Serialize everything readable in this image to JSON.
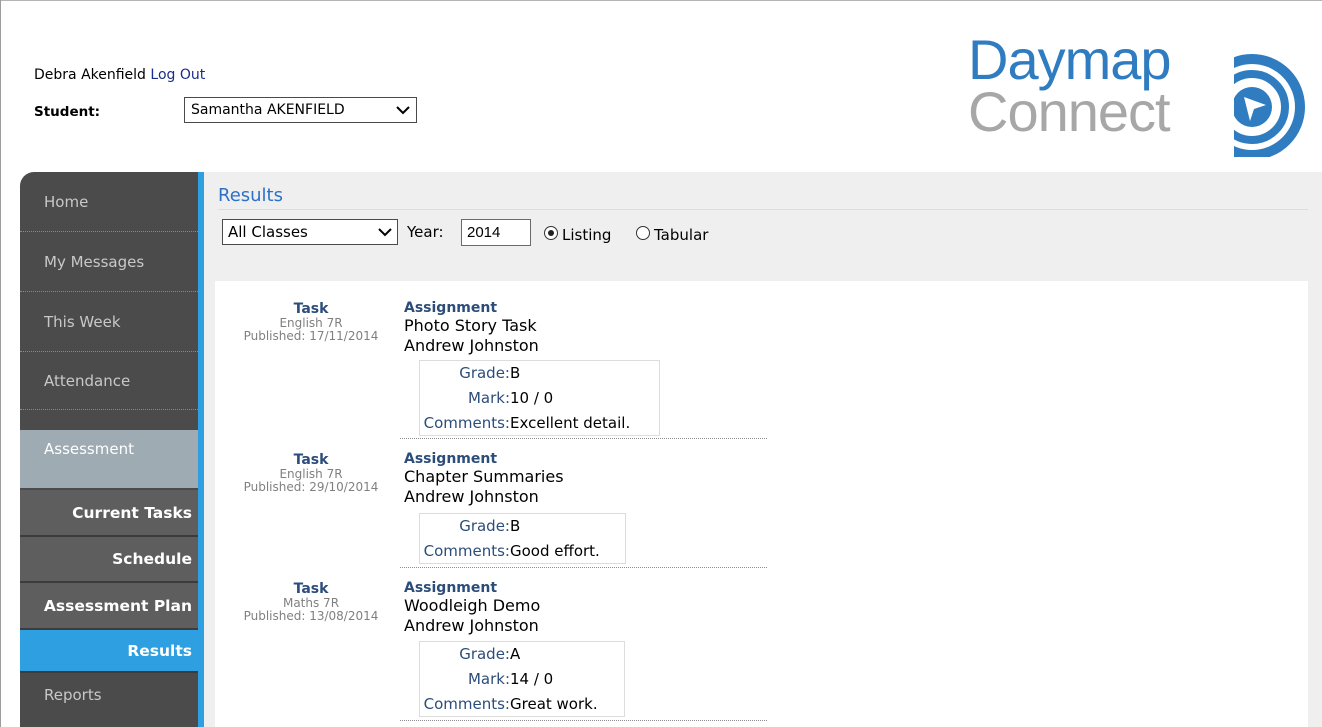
{
  "header": {
    "user_name": "Debra Akenfield",
    "logout_label": "Log Out",
    "student_label": "Student:",
    "student_selected": "Samantha AKENFIELD"
  },
  "logo": {
    "line1": "Daymap",
    "line2": "Connect",
    "colors": {
      "blue": "#2f7cc0",
      "grey": "#a7a7a7"
    }
  },
  "sidebar": {
    "items": [
      {
        "label": "Home"
      },
      {
        "label": "My Messages"
      },
      {
        "label": "This Week"
      },
      {
        "label": "Attendance"
      },
      {
        "label": "Assessment"
      },
      {
        "label": "Reports"
      }
    ],
    "sub_items": [
      {
        "label": "Current Tasks"
      },
      {
        "label": "Schedule"
      },
      {
        "label": "Assessment Plan"
      },
      {
        "label": "Results"
      }
    ],
    "active_section": "Assessment",
    "current_sub": "Results",
    "accent_color": "#2e9fe0"
  },
  "main": {
    "title": "Results",
    "class_filter": "All Classes",
    "year_label": "Year:",
    "year_value": "2014",
    "view_options": [
      "Listing",
      "Tabular"
    ],
    "view_selected": "Listing"
  },
  "results": [
    {
      "task_label": "Task",
      "class": "English 7R",
      "published": "Published: 17/11/2014",
      "type_label": "Assignment",
      "name": "Photo Story Task",
      "teacher": "Andrew Johnston",
      "grade_label": "Grade:",
      "grade": "B",
      "mark_label": "Mark:",
      "mark": "10 / 0",
      "comments_label": "Comments:",
      "comments": "Excellent detail."
    },
    {
      "task_label": "Task",
      "class": "English 7R",
      "published": "Published: 29/10/2014",
      "type_label": "Assignment",
      "name": "Chapter Summaries",
      "teacher": "Andrew Johnston",
      "grade_label": "Grade:",
      "grade": "B",
      "comments_label": "Comments:",
      "comments": "Good effort."
    },
    {
      "task_label": "Task",
      "class": "Maths 7R",
      "published": "Published: 13/08/2014",
      "type_label": "Assignment",
      "name": "Woodleigh Demo",
      "teacher": "Andrew Johnston",
      "grade_label": "Grade:",
      "grade": "A",
      "mark_label": "Mark:",
      "mark": "14 / 0",
      "comments_label": "Comments:",
      "comments": "Great work."
    }
  ]
}
